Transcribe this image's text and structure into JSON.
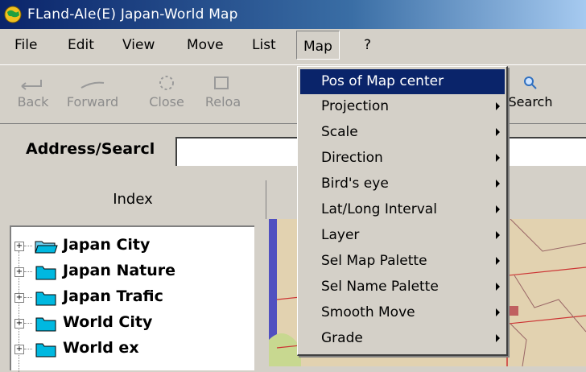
{
  "window": {
    "title": "FLand-Ale(E) Japan-World Map",
    "icon": "globe-icon"
  },
  "menubar": {
    "items": [
      "File",
      "Edit",
      "View",
      "Move",
      "List",
      "Map",
      "?"
    ],
    "open": "Map"
  },
  "toolbar": {
    "buttons": [
      {
        "label": "Back",
        "icon": "back-arrow-icon",
        "enabled": false
      },
      {
        "label": "Forward",
        "icon": "forward-arrow-icon",
        "enabled": false
      },
      {
        "label": "Close",
        "icon": "close-icon",
        "enabled": false
      },
      {
        "label": "Reloa",
        "icon": "reload-icon",
        "enabled": false
      },
      {
        "label": "Search",
        "icon": "search-icon",
        "enabled": true
      }
    ]
  },
  "address": {
    "label": "Address/Searcl",
    "value": ""
  },
  "index": {
    "header": "Index",
    "items": [
      "Japan City",
      "Japan Nature",
      "Japan Trafic",
      "World City",
      "World ex"
    ],
    "folder_color": "#00b8e0"
  },
  "map_menu": {
    "items": [
      {
        "label": "Pos of Map center",
        "submenu": false,
        "highlighted": true
      },
      {
        "label": "Projection",
        "submenu": true
      },
      {
        "label": "Scale",
        "submenu": true
      },
      {
        "label": "Direction",
        "submenu": true
      },
      {
        "label": "Bird's eye",
        "submenu": true
      },
      {
        "label": "Lat/Long Interval",
        "submenu": true
      },
      {
        "label": "Layer",
        "submenu": true
      },
      {
        "label": "Sel Map Palette",
        "submenu": true
      },
      {
        "label": "Sel Name Palette",
        "submenu": true
      },
      {
        "label": "Smooth Move",
        "submenu": true
      },
      {
        "label": "Grade",
        "submenu": true
      }
    ]
  },
  "colors": {
    "title_bar": "#0a246a",
    "highlight": "#0a246a",
    "map_land": "#e2d2b0",
    "map_lines": "#cc3333"
  }
}
